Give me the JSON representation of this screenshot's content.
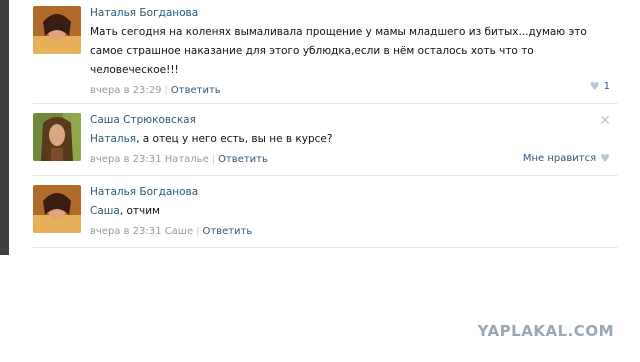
{
  "comments": [
    {
      "author": "Наталья Богданова",
      "text_lines": [
        "Мать сегодня на коленях вымаливала прощение у мамы младшего из битых...думаю это",
        "самое страшное наказание для этого ублюдка,если в нём осталось хоть что то",
        "человеческое!!!"
      ],
      "time": "вчера в 23:29",
      "reply_label": "Ответить",
      "likes": "1"
    },
    {
      "author": "Саша Стрюковская",
      "mention": "Наталья",
      "text_rest": ", а отец у него есть, вы не в курсе?",
      "time": "вчера в 23:31",
      "reply_to": "Наталье",
      "reply_label": "Ответить",
      "like_label": "Мне нравится",
      "close_symbol": "✕"
    },
    {
      "author": "Наталья Богданова",
      "mention": "Саша",
      "text_rest": ", отчим",
      "time": "вчера в 23:31",
      "reply_to": "Саше",
      "reply_label": "Ответить"
    }
  ],
  "watermark": "YAPLAKAL.COM",
  "colors": {
    "link": "#2b587a",
    "meta": "#999999",
    "divider": "#e4e8ee"
  }
}
